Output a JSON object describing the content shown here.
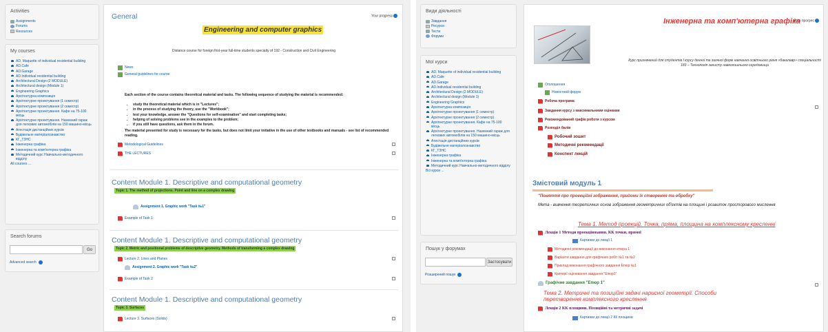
{
  "left": {
    "activities": {
      "title": "Activities",
      "items": [
        "Assignments",
        "Forums",
        "Resources"
      ]
    },
    "my_courses": {
      "title": "My courses",
      "items": [
        "AD. Maquette of individual residential building",
        "AD.Cafe",
        "AD.Garage",
        "AD.Individual residential building",
        "Architectural Design (2 MODULE)",
        "Architectural design (Module 1)",
        "Engineering Graphics",
        "Архітектурна композиція",
        "Архітектурне проектування (1 семестр)",
        "Архітектурне проектування (2 семестр)",
        "Архітектурне проектування. Кафе на 75-100 місць",
        "Архітектурне проектування. Наземний гараж для легкових автомобілів на 150 машино-місць",
        "Атестація дистанційних курсів",
        "Будівельне матеріалознавство",
        "КГ_ТЗНС",
        "Інженерна графіка",
        "Інженерна та комп'ютерна графіка",
        "Методичний курс Навчально-методичного відділу"
      ],
      "all": "All courses ..."
    },
    "search": {
      "title": "Search forums",
      "button": "Go",
      "advanced": "Advanced search"
    },
    "main": {
      "general": "General",
      "progress": "Your progress",
      "course_title": "Engineering and computer graphics",
      "subtitle": "Distance course for foreign first-year full-time students specialty of 192 - Construction and Civil Engineering",
      "news": "News",
      "guidelines": "General guidelines for course",
      "intro": "Each section of the course contains theoretical material and tasks. The following sequence of studying the material is recommended:",
      "bullets": [
        "study the theoretical material which is in \"Lectures\";",
        "in the process of studying the theory, use the \"Workbook\";",
        "test your knowledge, answer the \"Questions for self-examination\" and start completing tasks;",
        "helping of solving problems see in the examples to the problem;",
        "if you still have questions, ask them in the forum."
      ],
      "note": "The material presented for study is necessary for the tasks, but does not limit your initiative in the use of other textbooks and manuals - see list of recommended reading.",
      "method": "Metodological Guidelines",
      "lectures": "THE LECTURES",
      "s1_title": "Content Module 1. Descriptive and computational geometry",
      "s1_topic": "Topic 1. The method of projections. Point and line on a complex drawing",
      "s1_a": "Assignment 1. Graphic work \"Task №1\"",
      "s1_b": "Example of Task 1",
      "s2_title": "Content Module 1. Descriptive and computational geometry",
      "s2_topic": "Topic 2. Metric and positional problems of descriptive geometry. Methods of transforming a complex drawing",
      "s2_a": "Lecture 2. Lines and Planes",
      "s2_b": "Assignment 2. Graphic work \"Task №2\"",
      "s2_c": "Example of Task 2",
      "s3_title": "Content Module 1. Descriptive and computational geometry",
      "s3_topic": "Topic 3. Surfaces",
      "s3_a": "Lecture 3. Surfaces (Solids)"
    }
  },
  "right": {
    "activities": {
      "title": "Види діяльності",
      "items": [
        "Завдання",
        "Ресурси",
        "Тести",
        "Форуми"
      ]
    },
    "my_courses": {
      "title": "Мої курси",
      "items": [
        "AD. Maquette of individual residential building",
        "AD.Cafe",
        "AD.Garage",
        "AD.Individual residential building",
        "Architectural Design (2 MODULE)",
        "Architectural design (Module 1)",
        "Engineering Graphics",
        "Архітектурна композиція",
        "Архітектурне проектування (1 семестр)",
        "Архітектурне проектування (2 семестр)",
        "Архітектурне проектування. Кафе на 75-100 місць",
        "Архітектурне проектування. Наземний гараж для легкових автомобілів на 150 машино-місць",
        "Атестація дистанційних курсів",
        "Будівельне матеріалознавство",
        "КГ_ТЗНС",
        "Інженерна графіка",
        "Інженерна та комп'ютерна графіка",
        "Методичний курс Навчально-методичного відділу"
      ],
      "all": "Всі курси ..."
    },
    "search": {
      "title": "Пошук у форумах",
      "button": "Застосувати",
      "advanced": "Розширений пошук"
    },
    "main": {
      "course_title": "Інженерна та комп'ютерна графіка",
      "progress": "Ваш прогрес",
      "desc": "Курс призначений для студентів І курсу денної та заочної форм навчання освітнього рівня «бакалавр» спеціальності 183 – Технологія захисту навколишнього середовища",
      "announce": "Оголошення",
      "news_forum": "Новостной форум",
      "program": "Робоча програма",
      "tasks": "Завдання курсу з максимальними оцінками",
      "schedule": "Рекомендований графік роботи з курсом",
      "sections": "Розподіл балів",
      "workbook": "Робочий зошит",
      "method": "Методичні рекомендації",
      "konspekt": "Конспект лекцій",
      "module_title": "Змістовий модуль 1",
      "module_sub": "\"Поняття про проекційні зображення, прийоми їх створення та обробку\"",
      "meta": "Мета - вивчення теоретичних основ зображення геометричних об'єктів на площині і розвиток просторового мислення",
      "t1": "Тема 1. Метод проекцій. Точка, пряма, площина на комплексному кресленні",
      "l1": "Лекція 1 Методи проекціювання. КК точки, прямої",
      "l1_items": [
        "Картинки до лекції 1",
        "Методичні рекомендації до виконання епюра 1",
        "Варіанти завдання для графічних робіт №1 та №2",
        "Приклад виконання графічного завдання Епюр №1",
        "Критерії оцінювання завдання \"Епюр1\""
      ],
      "g1": "Графічне завдання \"Епюр 1\"",
      "t2": "Тема 2. Метричні та позиційні задачі нарисної геометрії. Способи перетворення комплексного креслення",
      "l2": "Лекція 2 КК площини. Позиційні та метричні задачі",
      "l2_item": "Картинки до лекції 2 КК площини"
    }
  }
}
